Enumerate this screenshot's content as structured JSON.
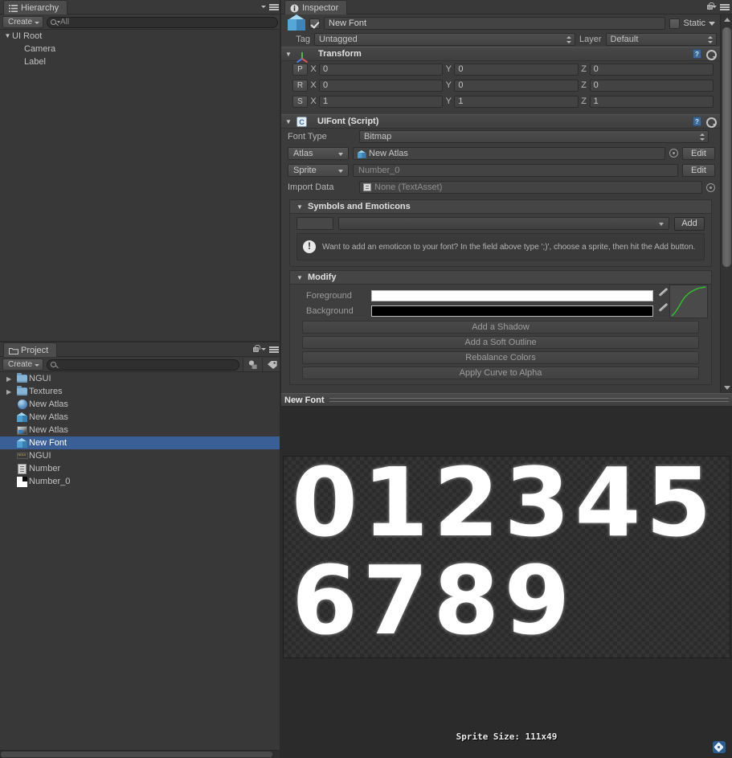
{
  "hierarchy": {
    "tab_label": "Hierarchy",
    "tab_icon": "hierarchy-icon",
    "create_label": "Create",
    "search_value": "All",
    "items": [
      {
        "label": "UI Root",
        "depth": 0,
        "arrow": "▼"
      },
      {
        "label": "Camera",
        "depth": 1,
        "arrow": ""
      },
      {
        "label": "Label",
        "depth": 1,
        "arrow": ""
      }
    ]
  },
  "project": {
    "tab_label": "Project",
    "tab_icon": "folder-icon",
    "create_label": "Create",
    "search_value": "",
    "tool_icons": [
      "filter-shapes-icon",
      "label-tag-icon"
    ],
    "items": [
      {
        "label": "NGUI",
        "arrow": "▶",
        "icon": "folder-icon",
        "selected": false
      },
      {
        "label": "Textures",
        "arrow": "▶",
        "icon": "folder-icon",
        "selected": false
      },
      {
        "label": "New Atlas",
        "arrow": "",
        "icon": "sphere-icon",
        "selected": false
      },
      {
        "label": "New Atlas",
        "arrow": "",
        "icon": "prefab-cube-icon",
        "selected": false
      },
      {
        "label": "New Atlas",
        "arrow": "",
        "icon": "texture-icon",
        "selected": false
      },
      {
        "label": "New Font",
        "arrow": "",
        "icon": "prefab-cube-icon",
        "selected": true
      },
      {
        "label": "NGUI",
        "arrow": "",
        "icon": "ngui-asset-icon",
        "selected": false
      },
      {
        "label": "Number",
        "arrow": "",
        "icon": "document-icon",
        "selected": false
      },
      {
        "label": "Number_0",
        "arrow": "",
        "icon": "checker-texture-icon",
        "selected": false
      }
    ]
  },
  "inspector": {
    "tab_label": "Inspector",
    "tab_icon": "info-icon",
    "object": {
      "enabled": true,
      "name": "New Font",
      "static_label": "Static",
      "static_checked": false,
      "tag_label": "Tag",
      "tag_value": "Untagged",
      "layer_label": "Layer",
      "layer_value": "Default"
    },
    "transform": {
      "title": "Transform",
      "rows": [
        {
          "key": "P",
          "x_label": "X",
          "x": "0",
          "y_label": "Y",
          "y": "0",
          "z_label": "Z",
          "z": "0"
        },
        {
          "key": "R",
          "x_label": "X",
          "x": "0",
          "y_label": "Y",
          "y": "0",
          "z_label": "Z",
          "z": "0"
        },
        {
          "key": "S",
          "x_label": "X",
          "x": "1",
          "y_label": "Y",
          "y": "1",
          "z_label": "Z",
          "z": "1"
        }
      ]
    },
    "uifont": {
      "title": "UIFont (Script)",
      "font_type_label": "Font Type",
      "font_type_value": "Bitmap",
      "atlas_button": "Atlas",
      "atlas_value": "New Atlas",
      "atlas_edit": "Edit",
      "sprite_button": "Sprite",
      "sprite_value": "Number_0",
      "sprite_edit": "Edit",
      "import_data_label": "Import Data",
      "import_data_value": "None (TextAsset)"
    },
    "symbols": {
      "title": "Symbols and Emoticons",
      "symbol_value": "",
      "sprite_select_value": "",
      "add_label": "Add",
      "help_text": "Want to add an emoticon to your font? In the field above type ';)', choose a sprite, then hit the Add button."
    },
    "modify": {
      "title": "Modify",
      "foreground_label": "Foreground",
      "foreground_color": "#ffffff",
      "background_label": "Background",
      "background_color": "#000000",
      "curve_color": "#2ec42e",
      "buttons": [
        "Add a Shadow",
        "Add a Soft Outline",
        "Rebalance Colors",
        "Apply Curve to Alpha"
      ]
    }
  },
  "preview": {
    "title": "New Font",
    "digits_line1": "012345",
    "digits_line2": "6789",
    "sprite_size_text": "Sprite Size: 111x49"
  },
  "colors": {
    "selection_blue": "#3a5f96",
    "panel_bg": "#383838",
    "inspector_bg": "#3c3c3c",
    "preview_bg": "#2b2b2b",
    "accent_curve": "#2ec42e"
  }
}
